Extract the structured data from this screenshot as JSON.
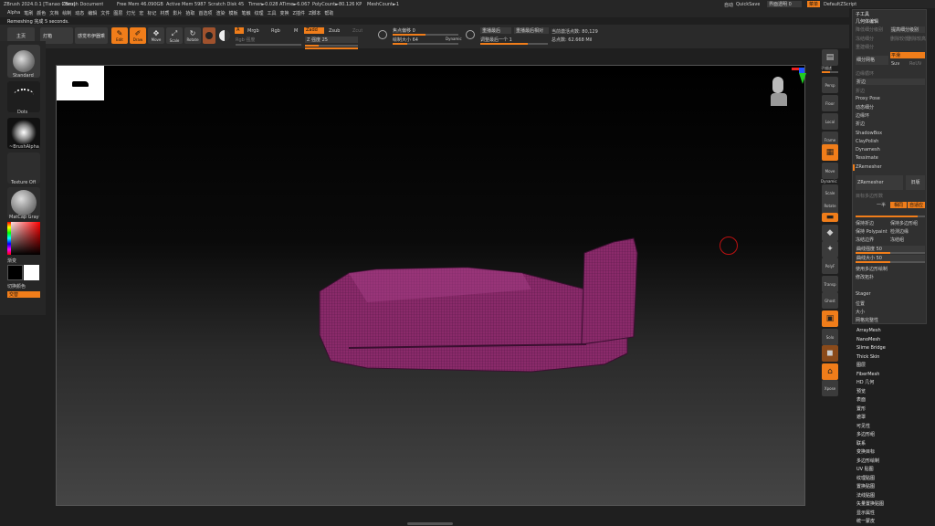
{
  "titlebar": {
    "app": "ZBrush 2024.0.1 [Tianao Chen]",
    "doc": "ZBrush Document",
    "free_mem": "Free Mem 46.090GB",
    "active_mem": "Active Mem 5987",
    "scratch": "Scratch Disk 45",
    "timer": "Timer►0.028 ATime►6.067",
    "polycount": "PolyCount►80.126 KP",
    "meshcount": "MeshCount►1",
    "autosave": "自动",
    "quicksave": "QuickSave",
    "transparency": "界面透明 0",
    "menu_btn": "菜单",
    "script": "DefaultZScript"
  },
  "menu": [
    "Alpha",
    "笔刷",
    "颜色",
    "文档",
    "绘制",
    "动态",
    "编辑",
    "文件",
    "图层",
    "灯光",
    "宏",
    "标记",
    "材质",
    "影片",
    "拾取",
    "首选项",
    "渲染",
    "模板",
    "笔触",
    "纹理",
    "工具",
    "变换",
    "Z插件",
    "Z脚本",
    "帮助"
  ],
  "status": "Remeshing 完成 5 seconds.",
  "toolbar": {
    "home": "主页",
    "lightbox": "灯箱",
    "lightbox_brush": "感觉布伊器乘",
    "edit": "Edit",
    "draw": "Draw",
    "move": "Move",
    "scale": "Scale",
    "rotate": "Rotate",
    "a_label": "A",
    "mrgb": "Mrgb",
    "rgb": "Rgb",
    "m": "M",
    "zadd": "Zadd",
    "zsub": "Zsub",
    "zcut": "Zcut",
    "rgb_intensity": "Rgb 强度",
    "z_intensity": "Z 强度 25",
    "focal_shift": "焦点偏移 0",
    "draw_size": "绘制大小 64",
    "dynamic": "Dynamic",
    "replay_last": "重播最后",
    "replay_last_rel": "重播最后相对",
    "adjust_last": "调整最后一个 1",
    "active_points": "当前激活点数: 80,129",
    "total_points": "总点数: 62.668 Mil"
  },
  "left": {
    "brush": "Standard",
    "stroke": "Dots",
    "alpha": "~BrushAlpha",
    "texture": "Texture Off",
    "material": "MatCap Gray",
    "gradient": "渐变",
    "switch_color": "切换颜色",
    "alternate": "交替"
  },
  "right_shelf": {
    "subtool_label": "子描述",
    "perspective": "Persp",
    "floor": "Floor",
    "local": "Local",
    "frame": "Frame",
    "move": "Move",
    "scale": "Scale",
    "rotate": "Rotate",
    "polyf": "PolyF",
    "transp": "Transp",
    "ghost": "Ghost",
    "solo": "Solo",
    "xpose": "Xpose",
    "dynamic": "Dynamic"
  },
  "panel": {
    "header": "子工具",
    "section": "几何体编辑",
    "lower_sub": "降低细分级别",
    "higher_sub": "提高细分级别",
    "del_lower": "删除较低",
    "del_higher": "删除较高",
    "freeze": "冻结细分",
    "reconstruct": "重建细分",
    "divide": "细分网格",
    "smooth": "平滑",
    "suv": "Suv",
    "reuv": "ReUV",
    "edge_loop": "边缘循环",
    "crease": "折边",
    "proxy": "Proxy Pose",
    "dyn_sub": "动态细分",
    "edgeloop": "边缘环",
    "shadowbox": "ShadowBox",
    "claypolish": "ClayPolish",
    "dynamesh": "Dynamesh",
    "tessimate": "Tessimate",
    "remesher": "ZRemesher",
    "zremesher_btn": "ZRemesher",
    "legacy": "旧版",
    "target_label": "目标多边形数",
    "half": "一半",
    "same": "相同",
    "adaptive": "自适应",
    "keep_creases": "保持折边",
    "keep_groups": "保持多边形组",
    "keep_poly": "保持 Polypaint",
    "detect_edges": "检测边缘",
    "freeze_border": "冻结边界",
    "freeze_groups": "冻结组",
    "curve_strength": "曲线强度 50",
    "curve_size": "曲线大小 50",
    "use_poly": "使用多边形绘制",
    "mod_topo": "修改拓扑",
    "position": "位置",
    "size": "大小",
    "mesh_integrity": "网格完整性",
    "stager": "Stager"
  },
  "right_list": [
    "ArrayMesh",
    "NanoMesh",
    "Slime Bridge",
    "Thick Skin",
    "图层",
    "FiberMesh",
    "HD 几何",
    "预览",
    "表面",
    "置形",
    "遮罩",
    "可见性",
    "多边形组",
    "联系",
    "变换目标",
    "多边形绘制",
    "UV 贴图",
    "纹理贴图",
    "置换贴图",
    "法线贴图",
    "矢量置换贴图",
    "显示属性",
    "统一蒙皮"
  ],
  "colors": {
    "accent": "#f07d1a",
    "mesh": "#8a2a6a"
  }
}
